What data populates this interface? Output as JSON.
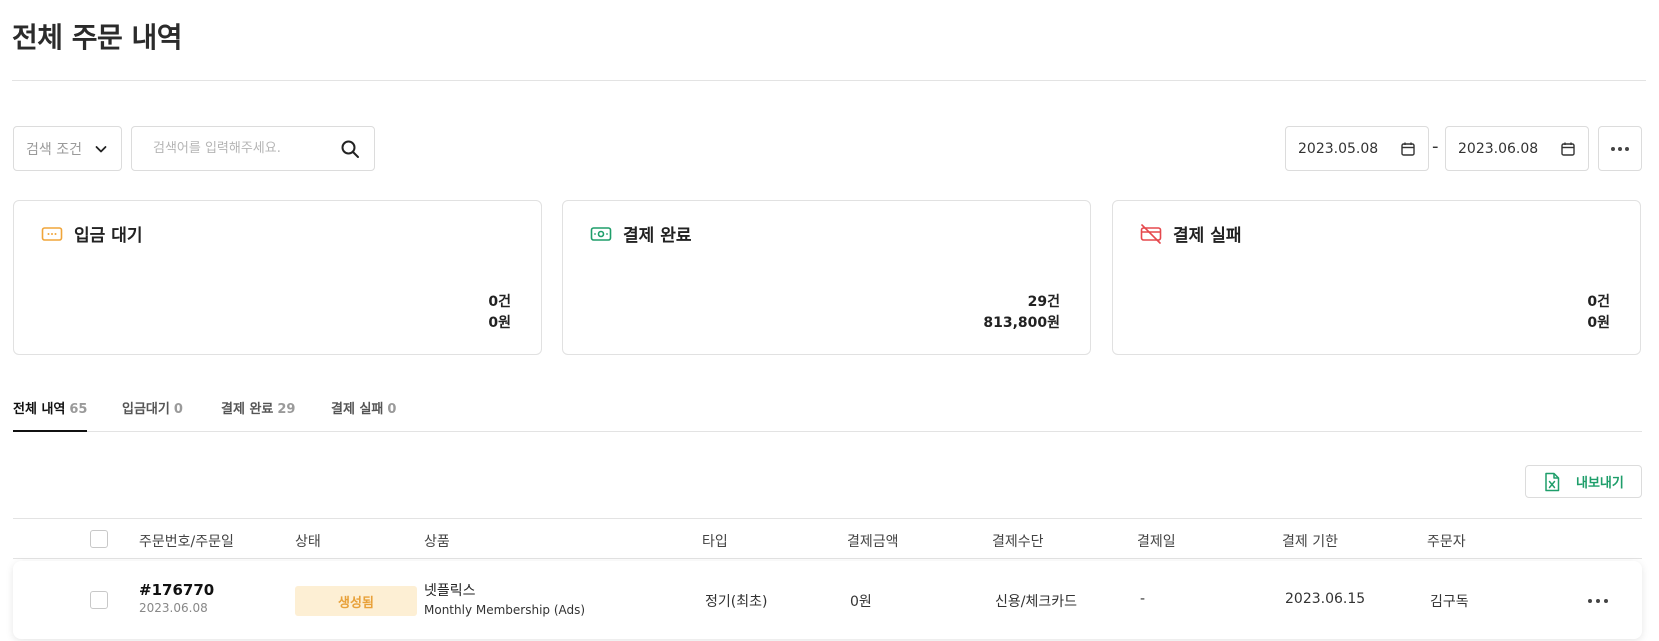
{
  "page": {
    "title": "전체 주문 내역"
  },
  "filters": {
    "search_condition": "검색 조건",
    "search_placeholder": "검색어를 입력해주세요.",
    "search_value": "",
    "date_start": "2023.05.08",
    "date_separator": "-",
    "date_end": "2023.06.08"
  },
  "cards": [
    {
      "title": "입금 대기",
      "count": "0건",
      "amount": "0원",
      "icon": "card-pending-icon",
      "color": "#f0a53a"
    },
    {
      "title": "결제 완료",
      "count": "29건",
      "amount": "813,800원",
      "icon": "cash-icon",
      "color": "#1e9e6a"
    },
    {
      "title": "결제 실패",
      "count": "0건",
      "amount": "0원",
      "icon": "card-off-icon",
      "color": "#e5484d"
    }
  ],
  "tabs": [
    {
      "label": "전체 내역",
      "count": "65",
      "active": true
    },
    {
      "label": "입금대기",
      "count": "0",
      "active": false
    },
    {
      "label": "결제 완료",
      "count": "29",
      "active": false
    },
    {
      "label": "결제 실패",
      "count": "0",
      "active": false
    }
  ],
  "export": {
    "label": "내보내기",
    "icon": "excel-icon"
  },
  "table": {
    "columns": [
      "주문번호/주문일",
      "상태",
      "상품",
      "타입",
      "결제금액",
      "결제수단",
      "결제일",
      "결제 기한",
      "주문자"
    ],
    "rows": [
      {
        "order_no": "#176770",
        "order_date": "2023.06.08",
        "status": "생성됨",
        "product_name": "넷플릭스",
        "product_plan": "Monthly Membership (Ads)",
        "type": "정기(최초)",
        "amount": "0원",
        "method": "신용/체크카드",
        "paid_date": "-",
        "due_date": "2023.06.15",
        "customer": "김구독"
      }
    ]
  },
  "colors": {
    "accent_green": "#1e9e6a",
    "pending_orange": "#f0a53a",
    "fail_red": "#e5484d",
    "badge_bg": "#fdefd4"
  }
}
